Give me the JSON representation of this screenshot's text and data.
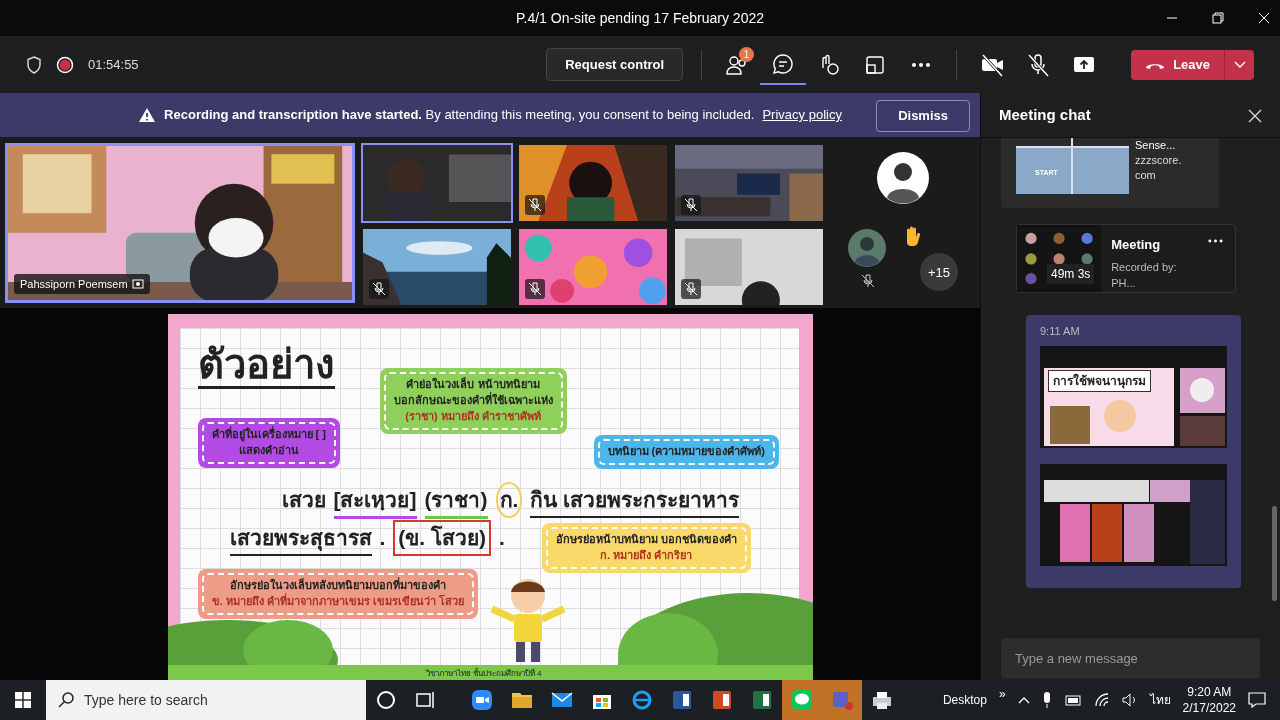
{
  "window": {
    "title": "P.4/1 On-site pending 17 February 2022"
  },
  "toolbar": {
    "recording": true,
    "timer": "01:54:55",
    "request_control": "Request control",
    "tools": [
      {
        "kind": "people",
        "badge": "1",
        "selected": false
      },
      {
        "kind": "chat",
        "selected": true
      },
      {
        "kind": "reactions",
        "selected": false
      },
      {
        "kind": "rooms",
        "selected": false
      },
      {
        "kind": "more",
        "selected": false
      }
    ],
    "media": [
      {
        "kind": "camera",
        "off": true
      },
      {
        "kind": "mic",
        "off": true
      },
      {
        "kind": "share",
        "off": false
      }
    ],
    "leave": "Leave"
  },
  "banner": {
    "text": "**Recording and transcription have started.** By attending this meeting, you consent to being included.",
    "link": "Privacy policy",
    "dismiss": "Dismiss"
  },
  "stage": {
    "presenter": {
      "name": "Pahssiporn Poemsem",
      "active": true
    },
    "tiles": [
      {
        "muted": false,
        "active": true
      },
      {
        "muted": true,
        "active": false
      },
      {
        "muted": true,
        "active": false
      },
      {
        "muted": true,
        "active": false
      },
      {
        "muted": true,
        "active": false
      },
      {
        "muted": true,
        "active": false
      }
    ],
    "side": {
      "hand_raised": true,
      "small_muted": true,
      "overflow": "+15"
    }
  },
  "slide": {
    "title": "ตัวอย่าง",
    "callouts": [
      {
        "color": "#b24be3",
        "lines": [
          "คำที่อยู่ในเครื่องหมาย [ ]",
          "แสดงคำอ่าน"
        ]
      },
      {
        "color": "#8fd05a",
        "lines": [
          "คำย่อในวงเล็บ หน้าบทนิยาม",
          "บอกลักษณะของคำที่ใช้เฉพาะแห่ง"
        ],
        "key_line": "(ราชา) หมายถึง คำราชาศัพท์"
      },
      {
        "color": "#4bb6ec",
        "lines": [
          "บทนิยาม (ความหมายของคำศัพท์)"
        ]
      },
      {
        "color": "#f9d96a",
        "lines": [
          "อักษรย่อหน้าบทนิยาม บอกชนิดของคำ"
        ],
        "key_line": "ก. หมายถึง คำกริยา"
      },
      {
        "color": "#ed9c88",
        "lines": [
          "อักษรย่อในวงเล็บหลังบทนิยามบอกที่มาของคำ"
        ],
        "key_line": "ข. หมายถึง คำที่มาจากภาษาเขมร เขมรเขียนว่า โสวย"
      }
    ],
    "line1": [
      "เสวย",
      "[สะเหฺวย]",
      "(ราชา)",
      "ก.",
      "กิน เสวยพระกระยาหาร"
    ],
    "line2": [
      "เสวยพระสุธารส",
      ".",
      "(ข. โสวย)",
      "."
    ],
    "footer": "วิชาภาษาไทย ชั้นประถมศึกษาปีที่ 4"
  },
  "chat": {
    "title": "Meeting chat",
    "messages": [
      {
        "kind": "link",
        "thumb_label": "START",
        "title": "Sense...",
        "domain": "zzzscore.com"
      },
      {
        "kind": "recording",
        "title": "Meeting",
        "subtitle": "Recorded by: PH...",
        "duration": "49m 3s"
      },
      {
        "kind": "images",
        "time": "9:11 AM",
        "caption": "การใช้พจนานุกรม"
      }
    ],
    "placeholder": "Type a new message"
  },
  "taskbar": {
    "search_placeholder": "Type here to search",
    "apps": [
      {
        "kind": "cortana",
        "flashing": false
      },
      {
        "kind": "taskview",
        "flashing": false
      },
      {
        "kind": "zoom",
        "flashing": false
      },
      {
        "kind": "explorer",
        "flashing": false
      },
      {
        "kind": "mail",
        "flashing": false
      },
      {
        "kind": "store",
        "flashing": false
      },
      {
        "kind": "ie",
        "flashing": false
      },
      {
        "kind": "word",
        "flashing": false
      },
      {
        "kind": "powerpoint",
        "flashing": false
      },
      {
        "kind": "excel",
        "flashing": false
      },
      {
        "kind": "line",
        "flashing": true
      },
      {
        "kind": "teams",
        "flashing": true
      },
      {
        "kind": "printer",
        "flashing": false
      }
    ],
    "desktop": "Desktop",
    "chevron": "»",
    "language": "ไทย",
    "time": "9:20 AM",
    "date": "2/17/2022"
  }
}
